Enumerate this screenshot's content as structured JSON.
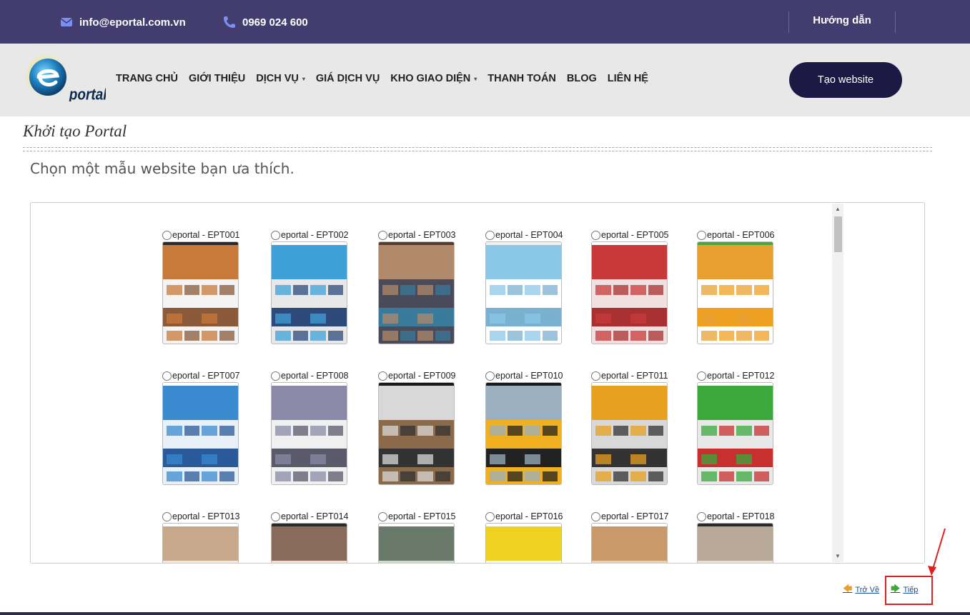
{
  "topbar": {
    "email": "info@eportal.com.vn",
    "phone": "0969 024 600",
    "help": "Hướng dẫn"
  },
  "logo": {
    "text": "portal"
  },
  "nav": [
    {
      "label": "TRANG CHỦ",
      "caret": false
    },
    {
      "label": "GIỚI THIỆU",
      "caret": false
    },
    {
      "label": "DỊCH VỤ",
      "caret": true
    },
    {
      "label": "GIÁ DỊCH VỤ",
      "caret": false
    },
    {
      "label": "KHO GIAO DIỆN",
      "caret": true
    },
    {
      "label": "THANH TOÁN",
      "caret": false
    },
    {
      "label": "BLOG",
      "caret": false
    },
    {
      "label": "LIÊN HỆ",
      "caret": false
    }
  ],
  "create_button": "Tạo website",
  "page_title": "Khởi tạo Portal",
  "subtitle": "Chọn một mẫu website bạn ưa thích.",
  "templates": [
    {
      "label": "eportal - EPT001",
      "colors": [
        "#2a2a2a",
        "#c87a3a",
        "#f4f4f4",
        "#8a5a3a"
      ]
    },
    {
      "label": "eportal - EPT002",
      "colors": [
        "#ffffff",
        "#3fa0d8",
        "#e8e8e8",
        "#2c4a7a"
      ]
    },
    {
      "label": "eportal - EPT003",
      "colors": [
        "#5a3a2a",
        "#b08a6a",
        "#4a4a5a",
        "#3a7a9a"
      ]
    },
    {
      "label": "eportal - EPT004",
      "colors": [
        "#f0f0f0",
        "#8ac8e8",
        "#ffffff",
        "#7ab0d0"
      ]
    },
    {
      "label": "eportal - EPT005",
      "colors": [
        "#ffffff",
        "#c83a3a",
        "#f0e0e0",
        "#a83030"
      ]
    },
    {
      "label": "eportal - EPT006",
      "colors": [
        "#4aa83a",
        "#e8a030",
        "#ffffff",
        "#f0a020"
      ]
    },
    {
      "label": "eportal - EPT007",
      "colors": [
        "#ffffff",
        "#3a8ad0",
        "#e8f0f8",
        "#2a5a9a"
      ]
    },
    {
      "label": "eportal - EPT008",
      "colors": [
        "#ffffff",
        "#8a8aa8",
        "#f0f0f0",
        "#5a5a6a"
      ]
    },
    {
      "label": "eportal - EPT009",
      "colors": [
        "#1a1a1a",
        "#d8d8d8",
        "#8a6a4a",
        "#333333"
      ]
    },
    {
      "label": "eportal - EPT010",
      "colors": [
        "#1a1a1a",
        "#9ab0c0",
        "#f0b020",
        "#222222"
      ]
    },
    {
      "label": "eportal - EPT011",
      "colors": [
        "#ffffff",
        "#e8a020",
        "#d8d8d8",
        "#333333"
      ]
    },
    {
      "label": "eportal - EPT012",
      "colors": [
        "#ffffff",
        "#3aa83a",
        "#e8e8e8",
        "#c83030"
      ]
    },
    {
      "label": "eportal - EPT013",
      "colors": [
        "#ffffff",
        "#c8a88a",
        "#f0e8e0",
        "#8a6a4a"
      ]
    },
    {
      "label": "eportal - EPT014",
      "colors": [
        "#2a2a2a",
        "#8a6a5a",
        "#f0e0d0",
        "#5a4a3a"
      ]
    },
    {
      "label": "eportal - EPT015",
      "colors": [
        "#ffffff",
        "#6a7a6a",
        "#d0d8d0",
        "#4a5a4a"
      ]
    },
    {
      "label": "eportal - EPT016",
      "colors": [
        "#ffffff",
        "#f0d020",
        "#f8f8f8",
        "#c8a830"
      ]
    },
    {
      "label": "eportal - EPT017",
      "colors": [
        "#ffffff",
        "#c89a6a",
        "#e8d0b0",
        "#8a6a4a"
      ]
    },
    {
      "label": "eportal - EPT018",
      "colors": [
        "#2a2a2a",
        "#b8a898",
        "#e8e0d8",
        "#7a6a5a"
      ]
    }
  ],
  "footer": {
    "back": "Trở Về",
    "next": "Tiếp"
  },
  "colors": {
    "topbar_bg": "#433c6e",
    "navbar_bg": "#e8e8e8",
    "button_bg": "#1c1a45",
    "highlight": "#e02020"
  }
}
